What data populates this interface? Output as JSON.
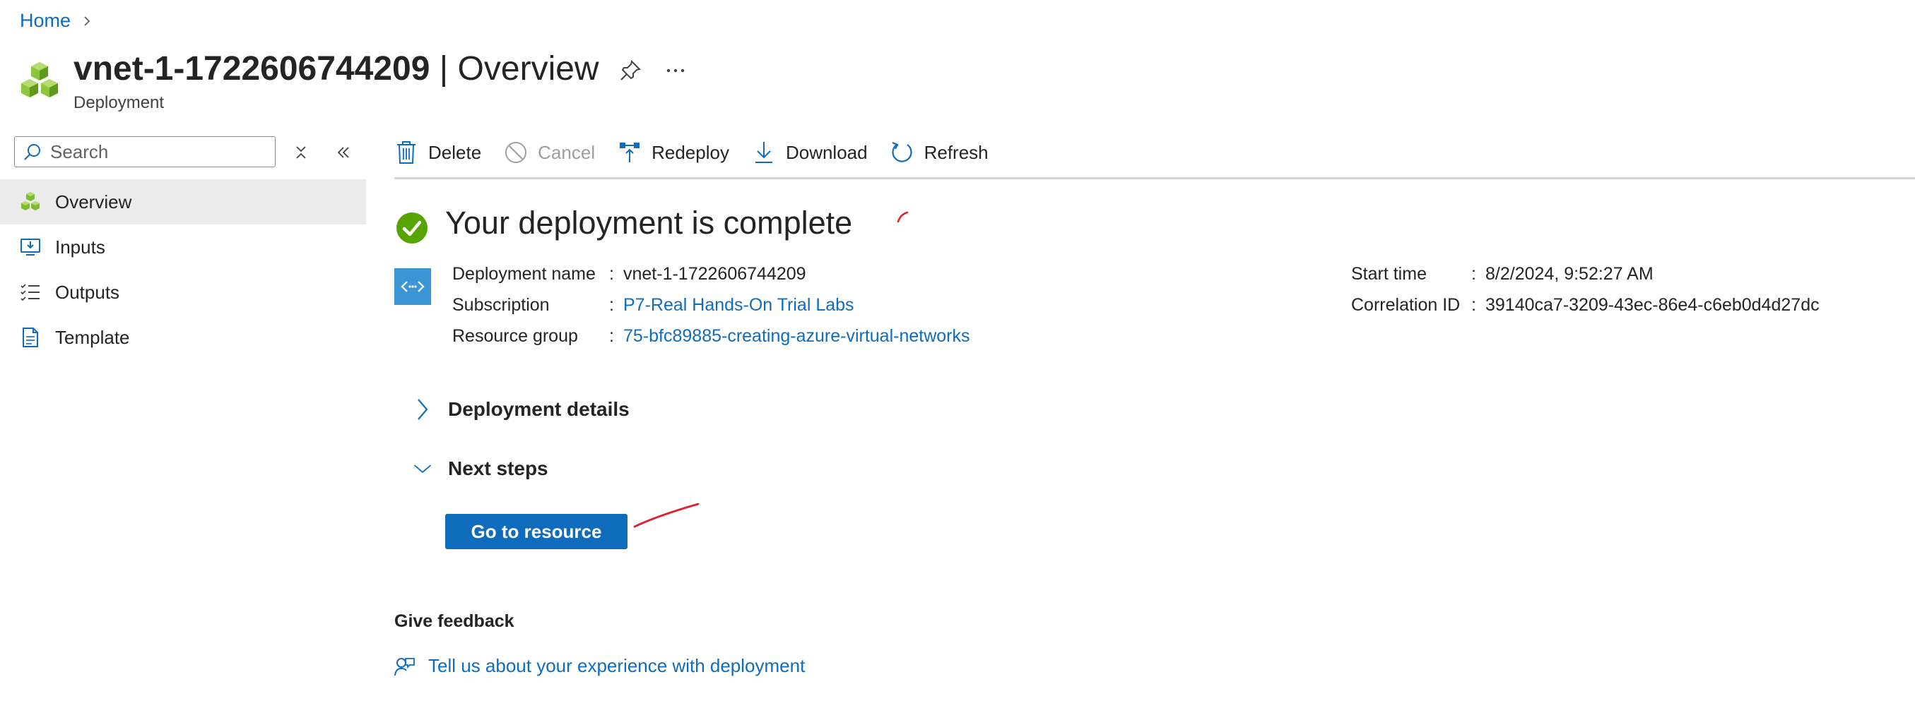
{
  "breadcrumb": {
    "home": "Home"
  },
  "header": {
    "resource_name": "vnet-1-1722606744209",
    "title_suffix": " | Overview",
    "subtitle": "Deployment"
  },
  "sidebar": {
    "search_placeholder": "Search",
    "items": [
      {
        "label": "Overview",
        "icon": "overview-icon",
        "active": true
      },
      {
        "label": "Inputs",
        "icon": "inputs-icon"
      },
      {
        "label": "Outputs",
        "icon": "outputs-icon"
      },
      {
        "label": "Template",
        "icon": "template-icon"
      }
    ]
  },
  "toolbar": {
    "delete": "Delete",
    "cancel": "Cancel",
    "redeploy": "Redeploy",
    "download": "Download",
    "refresh": "Refresh"
  },
  "main": {
    "heading": "Your deployment is complete",
    "details": {
      "deployment_name_label": "Deployment name",
      "deployment_name_value": "vnet-1-1722606744209",
      "subscription_label": "Subscription",
      "subscription_value": "P7-Real Hands-On Trial Labs",
      "resource_group_label": "Resource group",
      "resource_group_value": "75-bfc89885-creating-azure-virtual-networks",
      "start_time_label": "Start time",
      "start_time_value": "8/2/2024, 9:52:27 AM",
      "correlation_id_label": "Correlation ID",
      "correlation_id_value": "39140ca7-3209-43ec-86e4-c6eb0d4d27dc",
      "separator": ":"
    },
    "deployment_details": "Deployment details",
    "next_steps": "Next steps",
    "go_to_resource": "Go to resource",
    "feedback_title": "Give feedback",
    "feedback_link": "Tell us about your experience with deployment"
  },
  "colors": {
    "accent": "#0f6cbd",
    "success": "#57a300",
    "annotation": "#e0202a"
  }
}
